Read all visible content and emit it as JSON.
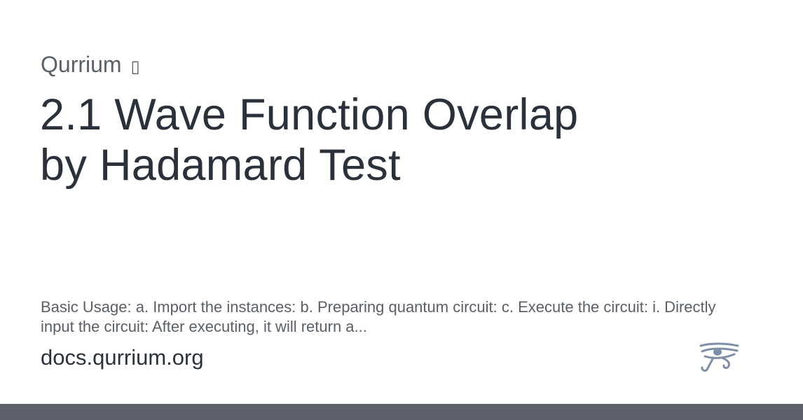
{
  "card": {
    "site_name": "Qurrium",
    "site_glyph": "▯",
    "title": "2.1 Wave Function Overlap by Hadamard Test",
    "description": "Basic Usage: a. Import the instances: b. Preparing quantum circuit: c. Execute the circuit: i. Directly input the circuit: After executing, it will return a...",
    "domain": "docs.qurrium.org",
    "logo_icon": "eye-of-horus-icon"
  },
  "colors": {
    "background": "#ffffff",
    "title_text": "#2b313a",
    "muted_text": "#5a5f68",
    "logo": "#7f8fa8",
    "bottom_bar": "#5b606b"
  }
}
